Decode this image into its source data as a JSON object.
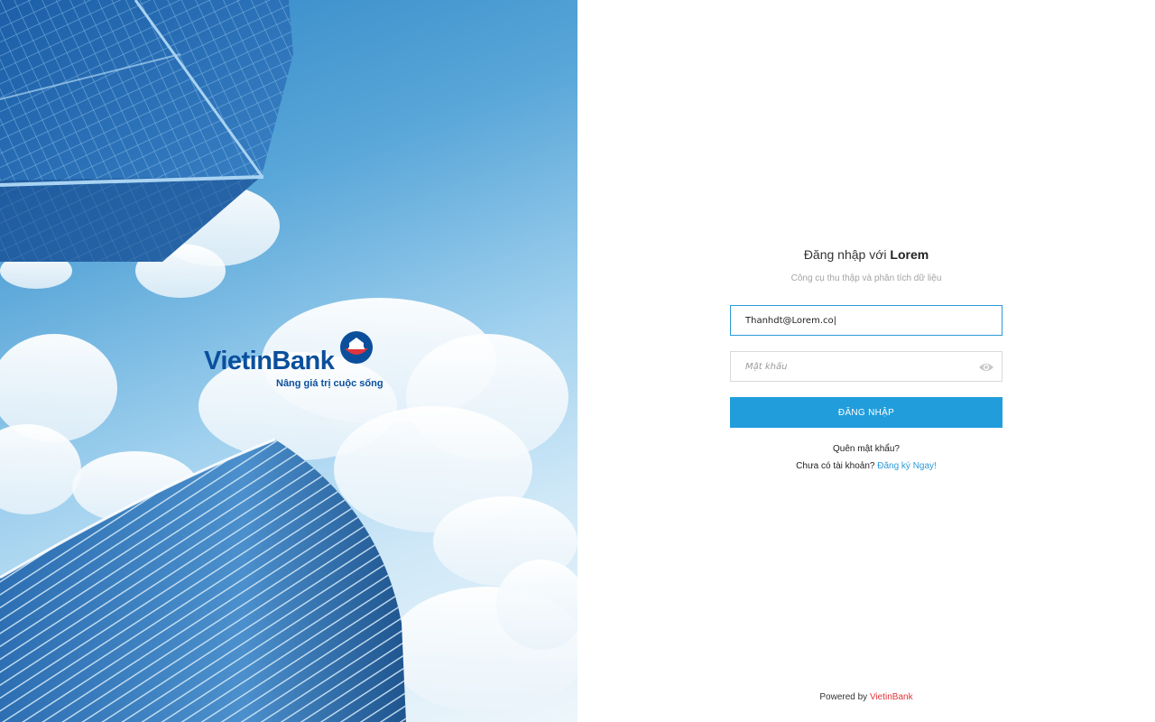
{
  "hero": {
    "brand_name": "VietinBank",
    "brand_tagline": "Nâng giá trị cuộc sống",
    "logo_icon": "vietinbank-logo-icon"
  },
  "login": {
    "title_prefix": "Đăng nhập với",
    "title_brand": "Lorem",
    "subtitle": "Công cụ thu thập và phân tích dữ liệu",
    "email_value": "Thanhdt@Lorem.co|",
    "password_placeholder": "Mật khẩu",
    "password_toggle_icon": "eye-icon",
    "submit_label": "ĐĂNG NHẬP",
    "forgot_label": "Quên mật khẩu?",
    "no_account_label": "Chưa có tài khoản?",
    "signup_label": "Đăng ký Ngay!"
  },
  "footer": {
    "powered_by": "Powered by",
    "powered_brand": "VietinBank"
  },
  "colors": {
    "accent": "#219ddb",
    "focus_border": "#2b9ad8",
    "link": "#2b9ad8",
    "footer_brand": "#e0353b",
    "brand_blue": "#0b4f9c",
    "brand_red": "#e0353b"
  }
}
